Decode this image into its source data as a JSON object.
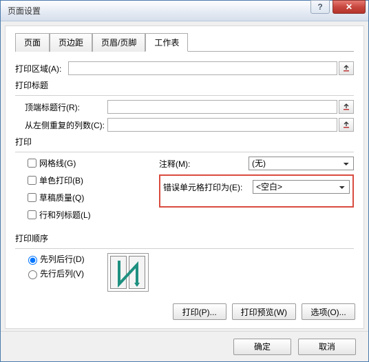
{
  "window": {
    "title": "页面设置"
  },
  "tabs": [
    "页面",
    "页边距",
    "页眉/页脚",
    "工作表"
  ],
  "activeTab": 3,
  "printArea": {
    "label": "打印区域(A):",
    "value": ""
  },
  "titlesGroup": {
    "label": "打印标题",
    "topRows": {
      "label": "顶端标题行(R):",
      "value": ""
    },
    "leftCols": {
      "label": "从左侧重复的列数(C):",
      "value": ""
    }
  },
  "printGroup": {
    "label": "打印",
    "gridlines": {
      "label": "网格线(G)",
      "checked": false
    },
    "blackWhite": {
      "label": "单色打印(B)",
      "checked": false
    },
    "draft": {
      "label": "草稿质量(Q)",
      "checked": false
    },
    "rowColHeaders": {
      "label": "行和列标题(L)",
      "checked": false
    },
    "comments": {
      "label": "注释(M):",
      "value": "(无)"
    },
    "errorsAs": {
      "label": "错误单元格打印为(E):",
      "value": "<空白>"
    }
  },
  "orderGroup": {
    "label": "打印顺序",
    "downOver": {
      "label": "先列后行(D)",
      "checked": true
    },
    "overDown": {
      "label": "先行后列(V)",
      "checked": false
    }
  },
  "buttons": {
    "print": "打印(P)...",
    "preview": "打印预览(W)",
    "options": "选项(O)...",
    "ok": "确定",
    "cancel": "取消"
  }
}
